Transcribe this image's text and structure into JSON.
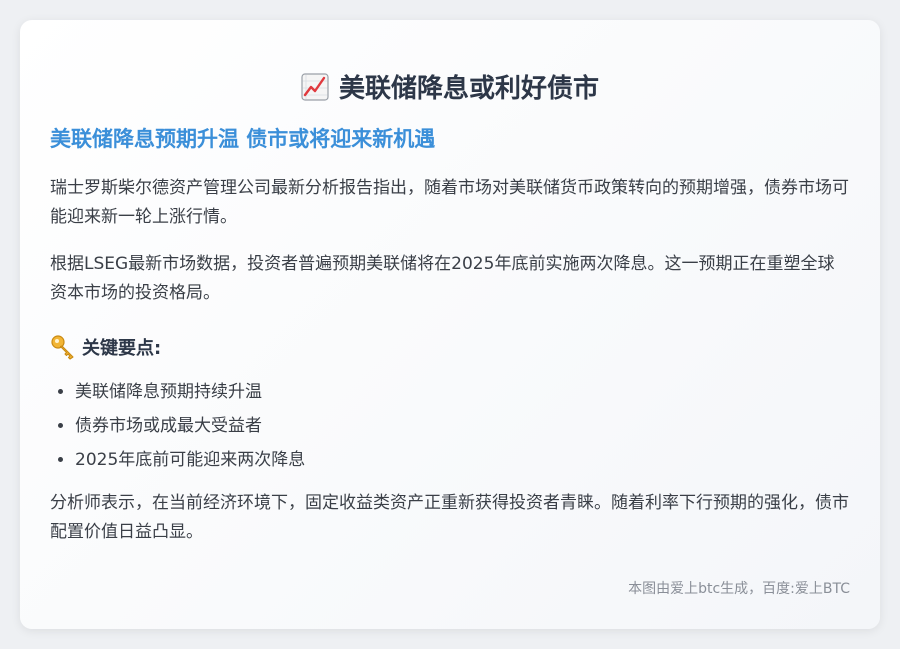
{
  "article": {
    "title": "美联储降息或利好债市",
    "title_icon": "chart-increasing-icon",
    "subtitle": "美联储降息预期升温 债市或将迎来新机遇",
    "paragraphs": [
      "瑞士罗斯柴尔德资产管理公司最新分析报告指出，随着市场对美联储货币政策转向的预期增强，债券市场可能迎来新一轮上涨行情。",
      "根据LSEG最新市场数据，投资者普遍预期美联储将在2025年底前实施两次降息。这一预期正在重塑全球资本市场的投资格局。"
    ],
    "key_points_heading": "关键要点:",
    "key_points_icon": "key-icon",
    "key_points": [
      "美联储降息预期持续升温",
      "债券市场或成最大受益者",
      "2025年底前可能迎来两次降息"
    ],
    "closing_paragraph": "分析师表示，在当前经济环境下，固定收益类资产正重新获得投资者青睐。随着利率下行预期的强化，债市配置价值日益凸显。",
    "footer": "本图由爱上btc生成，百度:爱上BTC"
  },
  "colors": {
    "title": "#2d3748",
    "subtitle": "#3b8fd9",
    "body": "#3a3f47",
    "footer": "#8a8f98"
  }
}
